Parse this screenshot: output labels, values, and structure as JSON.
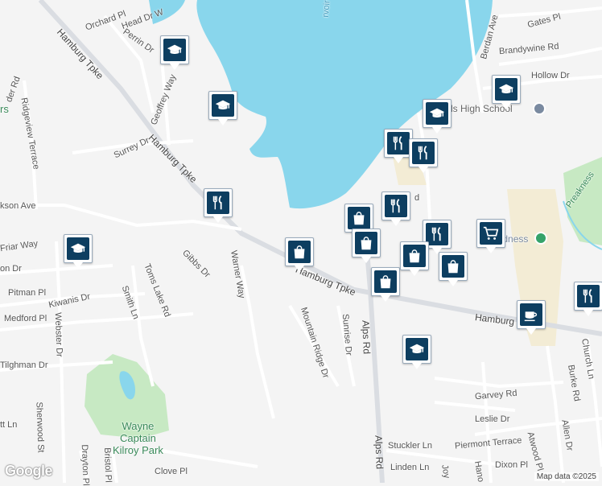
{
  "map": {
    "colors": {
      "water": "#89d6ec",
      "park": "#c7e9c3",
      "road": "#ffffff",
      "highway": "#dadde2",
      "background": "#f4f4f4",
      "commercial": "#f3ecd5",
      "pin": "#0d3e60"
    },
    "labels": {
      "orchard_pl": "Orchard Pl",
      "head_dr_w": "Head Dr W",
      "perrin_dr": "Perrin Dr",
      "hamburg_tpke_nw": "Hamburg Tpke",
      "hamburg_tpke_mid": "Hamburg Tpke",
      "hamburg_tpke_se": "Hamburg Tpke",
      "hamburg_tpke_e": "Hamburg",
      "geoffrey_way": "Geoffrey Way",
      "ridgeview_terrace": "Ridgeview Terrace",
      "surrey_dr": "Surrey Dr",
      "jackson_ave": "kson Ave",
      "friar_way": "Friar Way",
      "gibbs_dr": "Gibbs Dr",
      "warner_way": "Warner Way",
      "toms_lake_rd": "Toms Lake Rd",
      "smith_ln": "Smith Ln",
      "pitman_pl": "Pitman Pl",
      "kiwanis_dr": "Kiwanis Dr",
      "medford_pl": "Medford Pl",
      "webster_dr": "Webster Dr",
      "tilghman_dr": "Tilghman Dr",
      "sherwood_st": "Sherwood St",
      "drayton_pl": "Drayton Pl",
      "bristol_pl": "Bristol Pl",
      "clove_pl": "Clove Pl",
      "mountain_ridge_dr": "Mountain Ridge Dr",
      "sunrise_dr": "Sunrise Dr",
      "alps_rd_n": "Alps Rd",
      "alps_rd_s": "Alps Rd",
      "berdan_ave": "Berdan Ave",
      "gates_pl": "Gates Pl",
      "brandywine_rd": "Brandywine Rd",
      "hollow_dr": "Hollow Dr",
      "high_school": "ls High School",
      "preakness": "Preakness",
      "church_ln": "Church Ln",
      "burke_rd": "Burke Rd",
      "garvey_rd": "Garvey Rd",
      "leslie_dr": "Leslie Dr",
      "allen_dr": "Allen Dr",
      "atwood_pl": "Atwood Pl",
      "piermont_terrace": "Piermont Terrace",
      "stuckler_ln": "Stuckler Ln",
      "linden_ln": "Linden Ln",
      "dixon_pl": "Dixon Pl",
      "reservoir": "rvoir",
      "park_name": "Wayne\nCaptain\nKilroy Park",
      "store_name": "Lidness",
      "rder_rd": "der Rd",
      "on_dr": "on Dr",
      "tt_ln": "tt Ln",
      "rs": "rs",
      "rd_frag": "d",
      "joy_frag": "Joy",
      "hano_frag": "Hano"
    },
    "markers": [
      {
        "icon": "school-icon",
        "category": "school"
      },
      {
        "icon": "school-icon",
        "category": "school"
      },
      {
        "icon": "school-icon",
        "category": "school"
      },
      {
        "icon": "school-icon",
        "category": "school"
      },
      {
        "icon": "school-icon",
        "category": "school"
      },
      {
        "icon": "school-icon",
        "category": "school"
      },
      {
        "icon": "restaurant-icon",
        "category": "restaurant"
      },
      {
        "icon": "restaurant-icon",
        "category": "restaurant"
      },
      {
        "icon": "restaurant-icon",
        "category": "restaurant"
      },
      {
        "icon": "restaurant-icon",
        "category": "restaurant"
      },
      {
        "icon": "restaurant-icon",
        "category": "restaurant"
      },
      {
        "icon": "restaurant-icon",
        "category": "restaurant"
      },
      {
        "icon": "shopping-bag-icon",
        "category": "shopping"
      },
      {
        "icon": "shopping-bag-icon",
        "category": "shopping"
      },
      {
        "icon": "shopping-bag-icon",
        "category": "shopping"
      },
      {
        "icon": "shopping-bag-icon",
        "category": "shopping"
      },
      {
        "icon": "shopping-bag-icon",
        "category": "shopping"
      },
      {
        "icon": "shopping-bag-icon",
        "category": "shopping"
      },
      {
        "icon": "grocery-cart-icon",
        "category": "grocery"
      },
      {
        "icon": "coffee-cup-icon",
        "category": "cafe"
      }
    ],
    "attribution": "Map data ©2025",
    "logo": "Google"
  }
}
